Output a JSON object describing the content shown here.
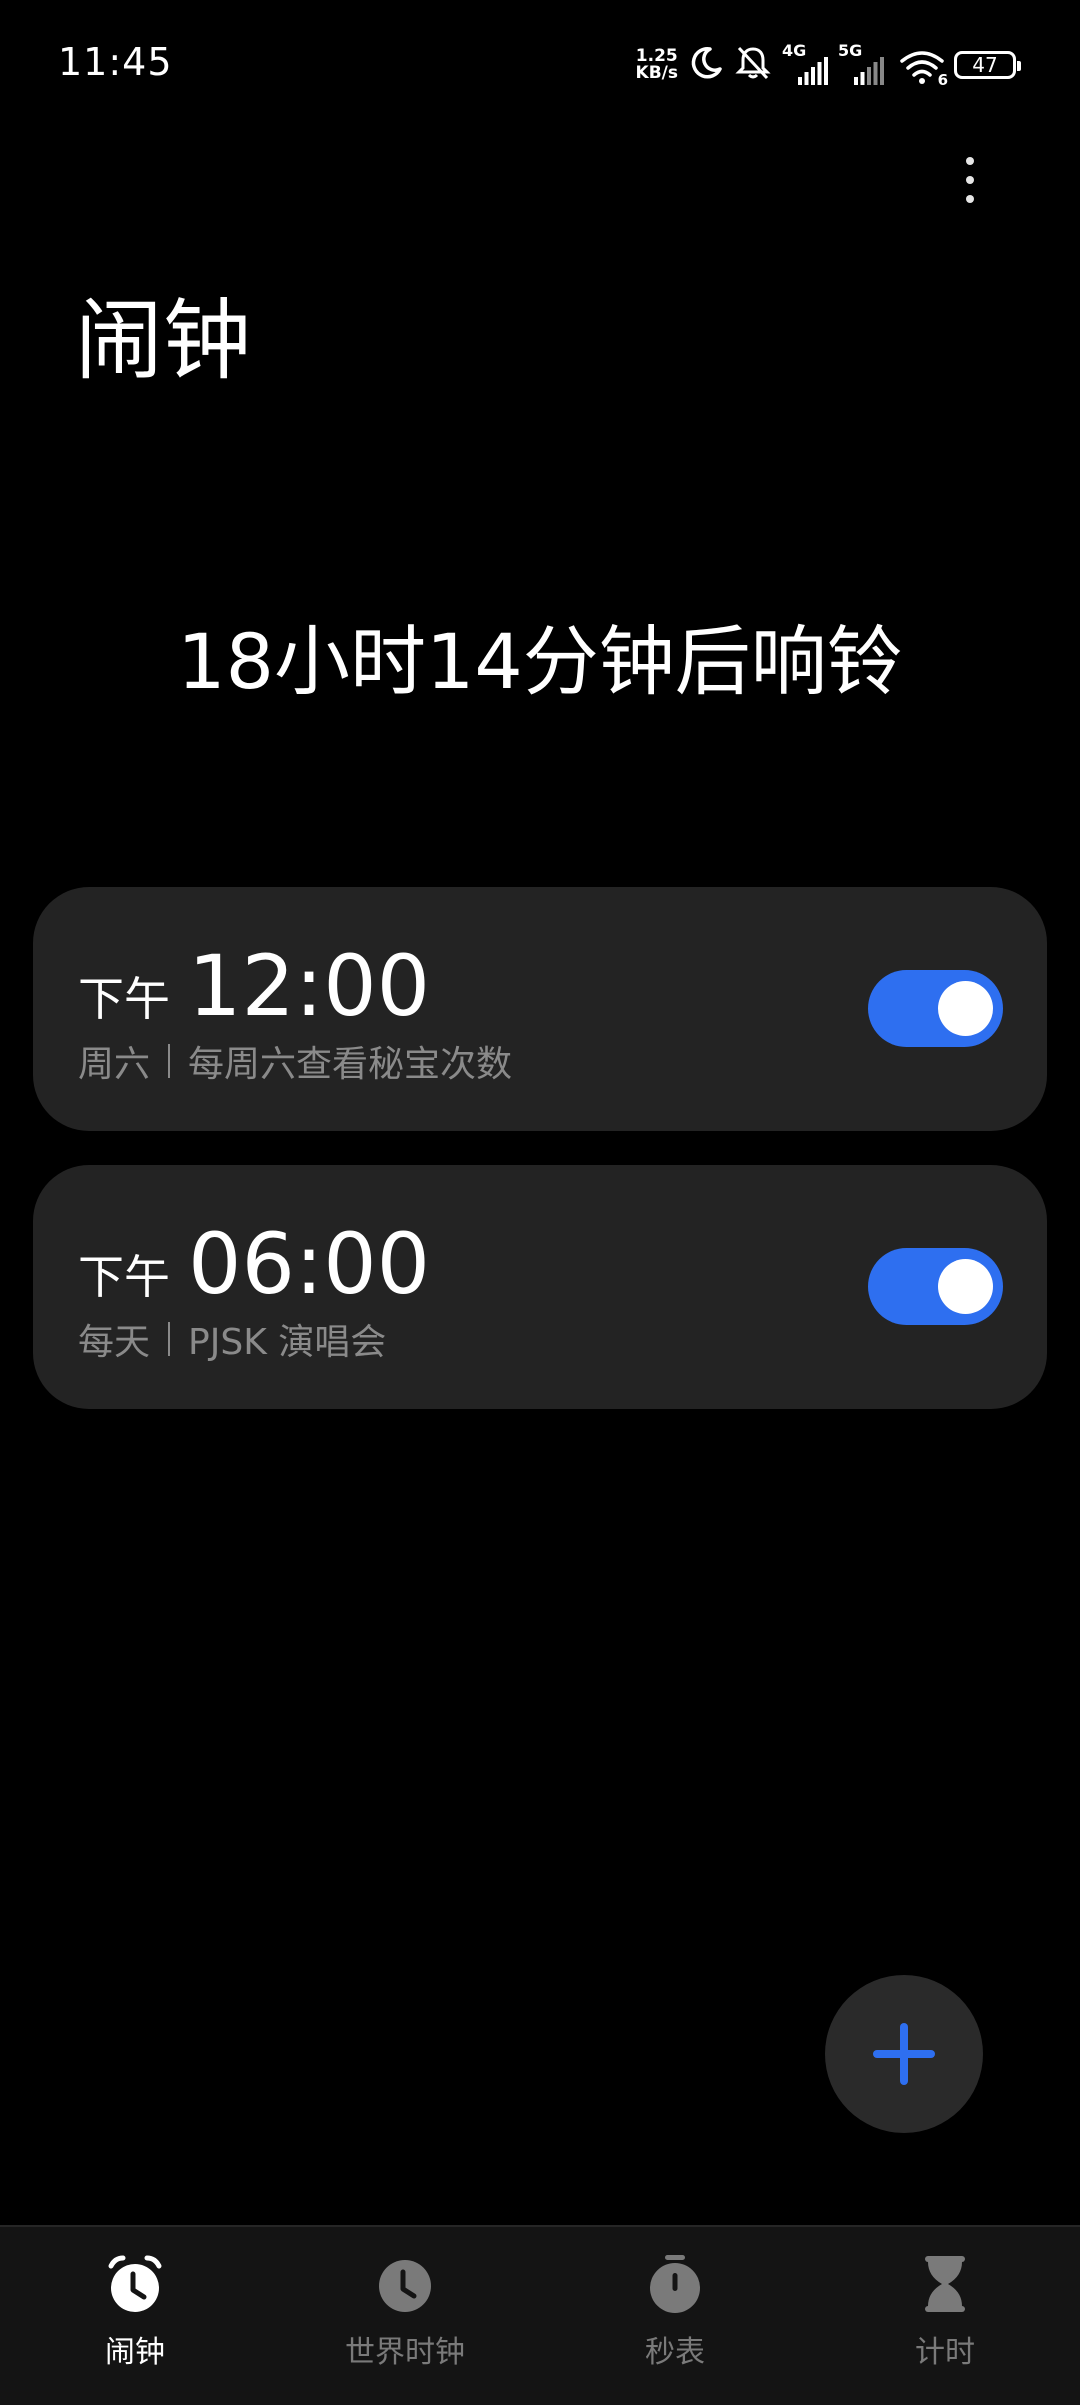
{
  "status_bar": {
    "time": "11:45",
    "net_speed_value": "1.25",
    "net_speed_unit": "KB/s",
    "signal1_label": "4G",
    "signal2_label": "5G",
    "wifi_sub": "6",
    "battery": "47"
  },
  "header": {
    "title": "闹钟",
    "menu_icon": "more-vertical-icon"
  },
  "next_alarm_text": "18小时14分钟后响铃",
  "alarms": [
    {
      "ampm": "下午",
      "time": "12:00",
      "repeat": "周六",
      "label": "每周六查看秘宝次数",
      "enabled": true
    },
    {
      "ampm": "下午",
      "time": "06:00",
      "repeat": "每天",
      "label": "PJSK 演唱会",
      "enabled": true
    }
  ],
  "fab": {
    "icon": "plus-icon"
  },
  "bottom_nav": {
    "items": [
      {
        "label": "闹钟",
        "icon": "alarm-clock-icon",
        "active": true
      },
      {
        "label": "世界时钟",
        "icon": "world-clock-icon",
        "active": false
      },
      {
        "label": "秒表",
        "icon": "stopwatch-icon",
        "active": false
      },
      {
        "label": "计时",
        "icon": "hourglass-icon",
        "active": false
      }
    ]
  },
  "colors": {
    "background": "#000000",
    "card": "#232323",
    "accent": "#2e6ff0",
    "secondary_text": "#8a8a8a",
    "nav_bg": "#141414"
  }
}
